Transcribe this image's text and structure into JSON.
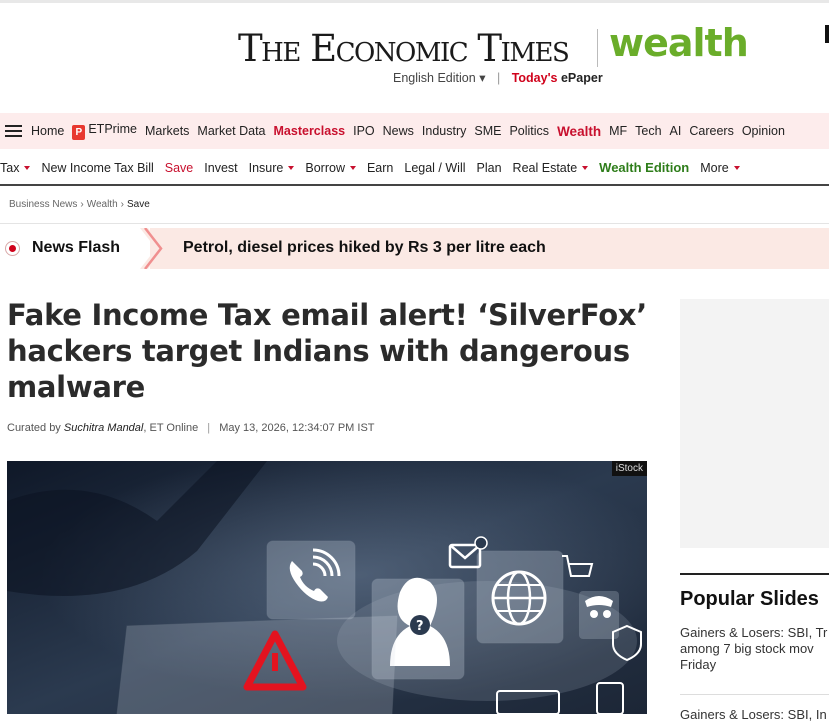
{
  "masthead": {
    "logo": "The Economic Times",
    "section_logo": "wealth",
    "edition_label": "English Edition",
    "separator": "|",
    "todays_label": "Today's",
    "epaper_label": "ePaper"
  },
  "nav_primary": {
    "items": [
      "Home",
      "ETPrime",
      "Markets",
      "Market Data",
      "Masterclass",
      "IPO",
      "News",
      "Industry",
      "SME",
      "Politics",
      "Wealth",
      "MF",
      "Tech",
      "AI",
      "Careers",
      "Opinion"
    ]
  },
  "nav_secondary": {
    "items": [
      "Tax",
      "New Income Tax Bill",
      "Save",
      "Invest",
      "Insure",
      "Borrow",
      "Earn",
      "Legal / Will",
      "Plan",
      "Real Estate",
      "Wealth Edition",
      "More"
    ]
  },
  "breadcrumb": {
    "items": [
      "Business News",
      "Wealth",
      "Save"
    ],
    "separator": "›"
  },
  "news_flash": {
    "label": "News Flash",
    "text": "Petrol, diesel prices hiked by Rs 3 per litre each"
  },
  "article": {
    "headline": "Fake Income Tax email alert! ‘SilverFox’ hackers target Indians with dangerous malware",
    "byline_prefix": "Curated by",
    "author": "Suchitra Mandal",
    "outlet": ", ET Online",
    "separator": "|",
    "datetime": "May 13, 2026, 12:34:07 PM IST",
    "image_credit": "iStock"
  },
  "sidebar": {
    "title": "Popular Slides",
    "items": [
      "Gainers & Losers: SBI, Tr among 7 big stock mov Friday",
      "Gainers & Losers: SBI, In"
    ]
  },
  "colors": {
    "accent_red": "#c8102e",
    "wealth_green": "#6aad2a",
    "nav_bg": "#fdecec",
    "flash_bg": "#fbe9e4"
  }
}
